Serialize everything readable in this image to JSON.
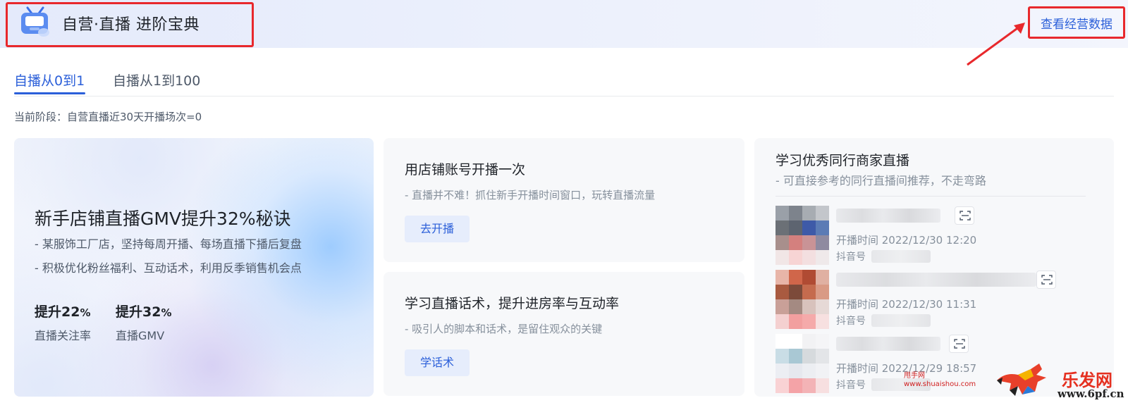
{
  "header": {
    "title": "自营·直播 进阶宝典",
    "data_link": "查看经营数据"
  },
  "tabs": [
    {
      "label": "自播从0到1",
      "active": true
    },
    {
      "label": "自播从1到100",
      "active": false
    }
  ],
  "stage": "当前阶段：自营直播近30天开播场次=0",
  "feature": {
    "title": "新手店铺直播GMV提升32%秘诀",
    "desc1": "- 某服饰工厂店，坚持每周开播、每场直播下播后复盘",
    "desc2": "- 积极优化粉丝福利、互动话术，利用反季销售机会点",
    "stats": [
      {
        "prefix": "提升",
        "num": "22",
        "unit": "%",
        "label": "直播关注率"
      },
      {
        "prefix": "提升",
        "num": "32",
        "unit": "%",
        "label": "直播GMV"
      }
    ]
  },
  "tasks": [
    {
      "title": "用店铺账号开播一次",
      "desc": "- 直播并不难！抓住新手开播时间窗口，玩转直播流量",
      "button": "去开播"
    },
    {
      "title": "学习直播话术，提升进房率与互动率",
      "desc": "- 吸引人的脚本和话术，是留住观众的关键",
      "button": "学话术"
    }
  ],
  "peers": {
    "title": "学习优秀同行商家直播",
    "subtitle": "- 可直接参考的同行直播间推荐，不走弯路",
    "items": [
      {
        "time": "开播时间 2022/12/30 12:20",
        "id_label": "抖音号",
        "thumb": [
          "#9aa0a8",
          "#7d838c",
          "#a7acb2",
          "#c3c6cb",
          "#6b7076",
          "#5d6470",
          "#3e5aa8",
          "#5b7bb5",
          "#a88f8c",
          "#d4807e",
          "#c99396",
          "#8f8aa0",
          "#f1e6e6",
          "#f7d4d4",
          "#f3dfe0",
          "#efe9ea"
        ]
      },
      {
        "time": "开播时间 2022/12/30 11:31",
        "id_label": "抖音号",
        "thumb": [
          "#e8b5a8",
          "#d0664a",
          "#b04b33",
          "#e0b0a2",
          "#a95a40",
          "#7c4a3a",
          "#c56b4e",
          "#d99a85",
          "#c9a098",
          "#a48a82",
          "#d8c2bc",
          "#e6d9d6",
          "#f4d0d0",
          "#f29f9f",
          "#f5aaaa",
          "#f7e0e0"
        ]
      },
      {
        "time": "开播时间 2022/12/29 18:57",
        "id_label": "抖音号",
        "thumb": [
          "#ffffff",
          "#ffffff",
          "#f2f2f4",
          "#f5f5f7",
          "#c9dde6",
          "#a9c8d4",
          "#d6dadd",
          "#e3e5e8",
          "#eceef3",
          "#e6e8ee",
          "#eceef2",
          "#f1f2f5",
          "#f9d2d4",
          "#f4a3a7",
          "#f3b3b6",
          "#f7dfe0"
        ]
      }
    ]
  },
  "watermark": {
    "site_cn": "甩手网",
    "site_url": "www.shuaishou.com",
    "logo_text": "乐发网",
    "logo_url": "www.6pf.cn"
  },
  "colors": {
    "accent": "#2b5fd9",
    "highlight_box": "#e8282c",
    "button_bg": "#e6edfc"
  }
}
